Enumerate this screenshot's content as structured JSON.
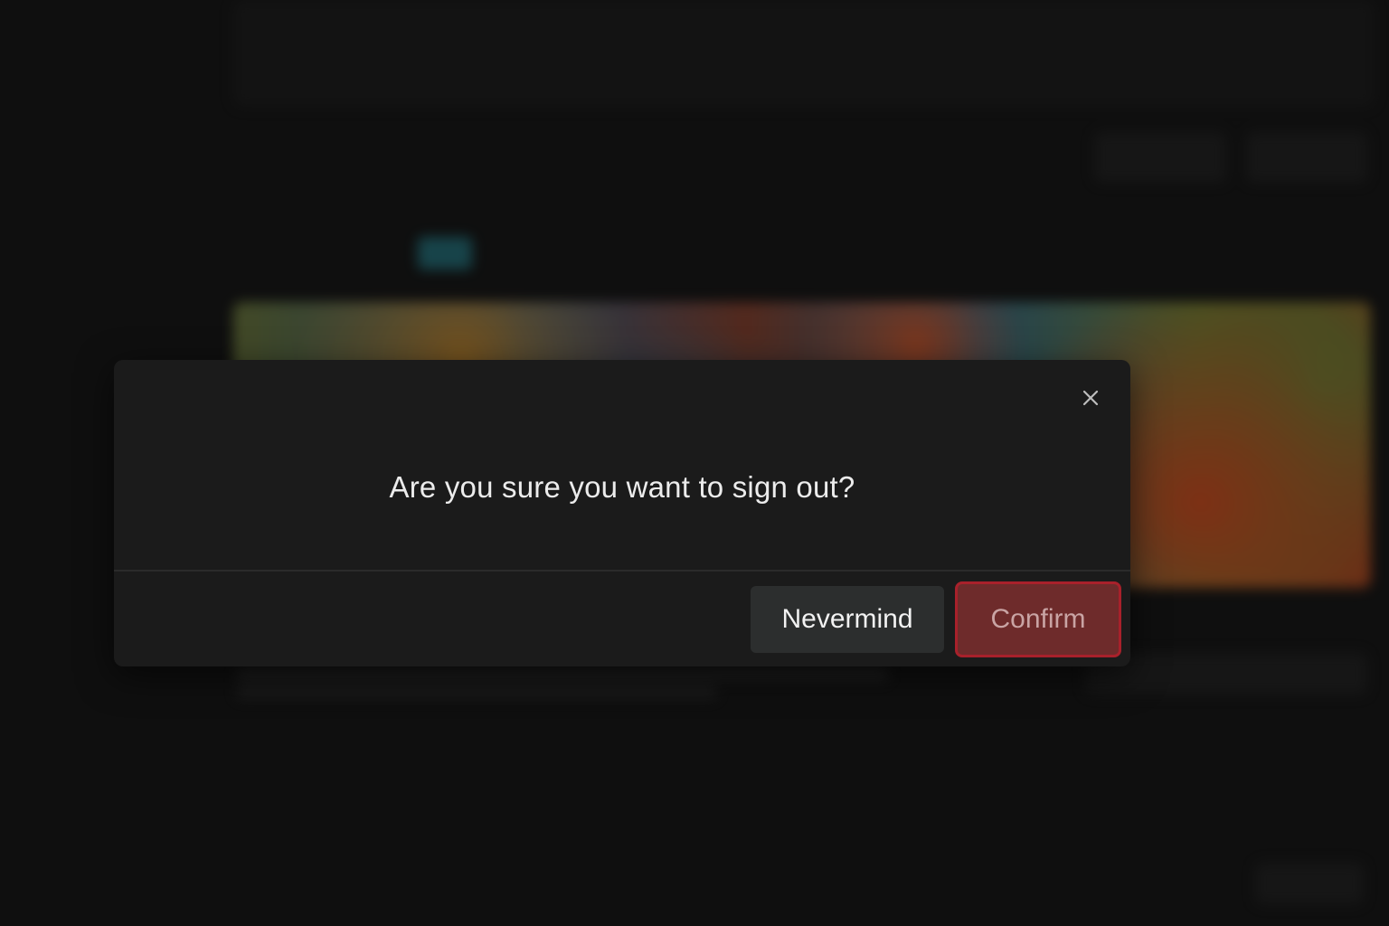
{
  "dialog": {
    "title": "Are you sure you want to sign out?",
    "close_icon": "close-icon",
    "nevermind_label": "Nevermind",
    "confirm_label": "Confirm"
  },
  "colors": {
    "dialog_bg": "#1b1b1b",
    "confirm_bg": "#6e2b2b",
    "confirm_border": "#a8212b",
    "nevermind_bg": "#2c2e2e"
  }
}
